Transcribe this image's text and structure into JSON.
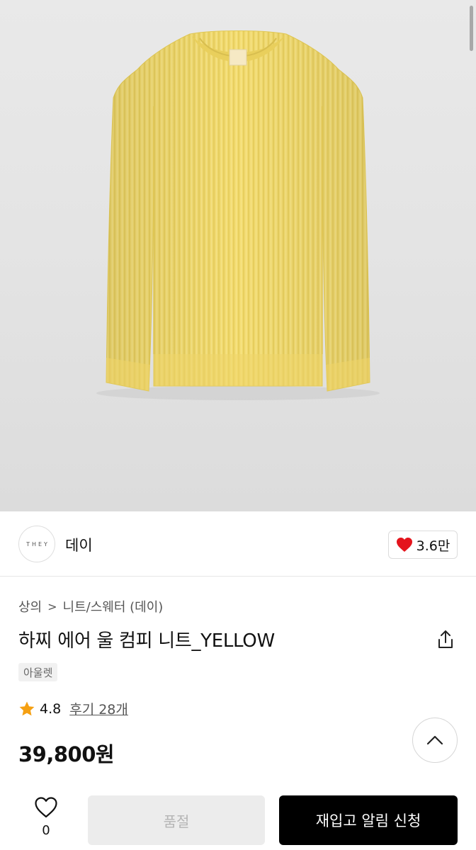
{
  "brand": {
    "logo_text": "THEY",
    "name": "데이",
    "likes": "3.6만"
  },
  "breadcrumb": {
    "category": "상의",
    "separator": ">",
    "subcategory": "니트/스웨터 (데이)"
  },
  "product": {
    "title": "하찌 에어 울 컴피 니트_YELLOW",
    "tag": "아울렛",
    "price": "39,800원"
  },
  "rating": {
    "score": "4.8",
    "reviews": "후기 28개"
  },
  "bottom": {
    "wish_count": "0",
    "soldout_label": "품절",
    "restock_label": "재입고 알림 신청"
  },
  "icons": [
    "heart-filled-icon",
    "share-icon",
    "star-icon",
    "chevron-up-icon",
    "heart-outline-icon"
  ],
  "colors": {
    "accent_heart": "#e4141c",
    "star": "#f5a012",
    "sweater": "#f3dc72",
    "button_dark": "#000000"
  }
}
